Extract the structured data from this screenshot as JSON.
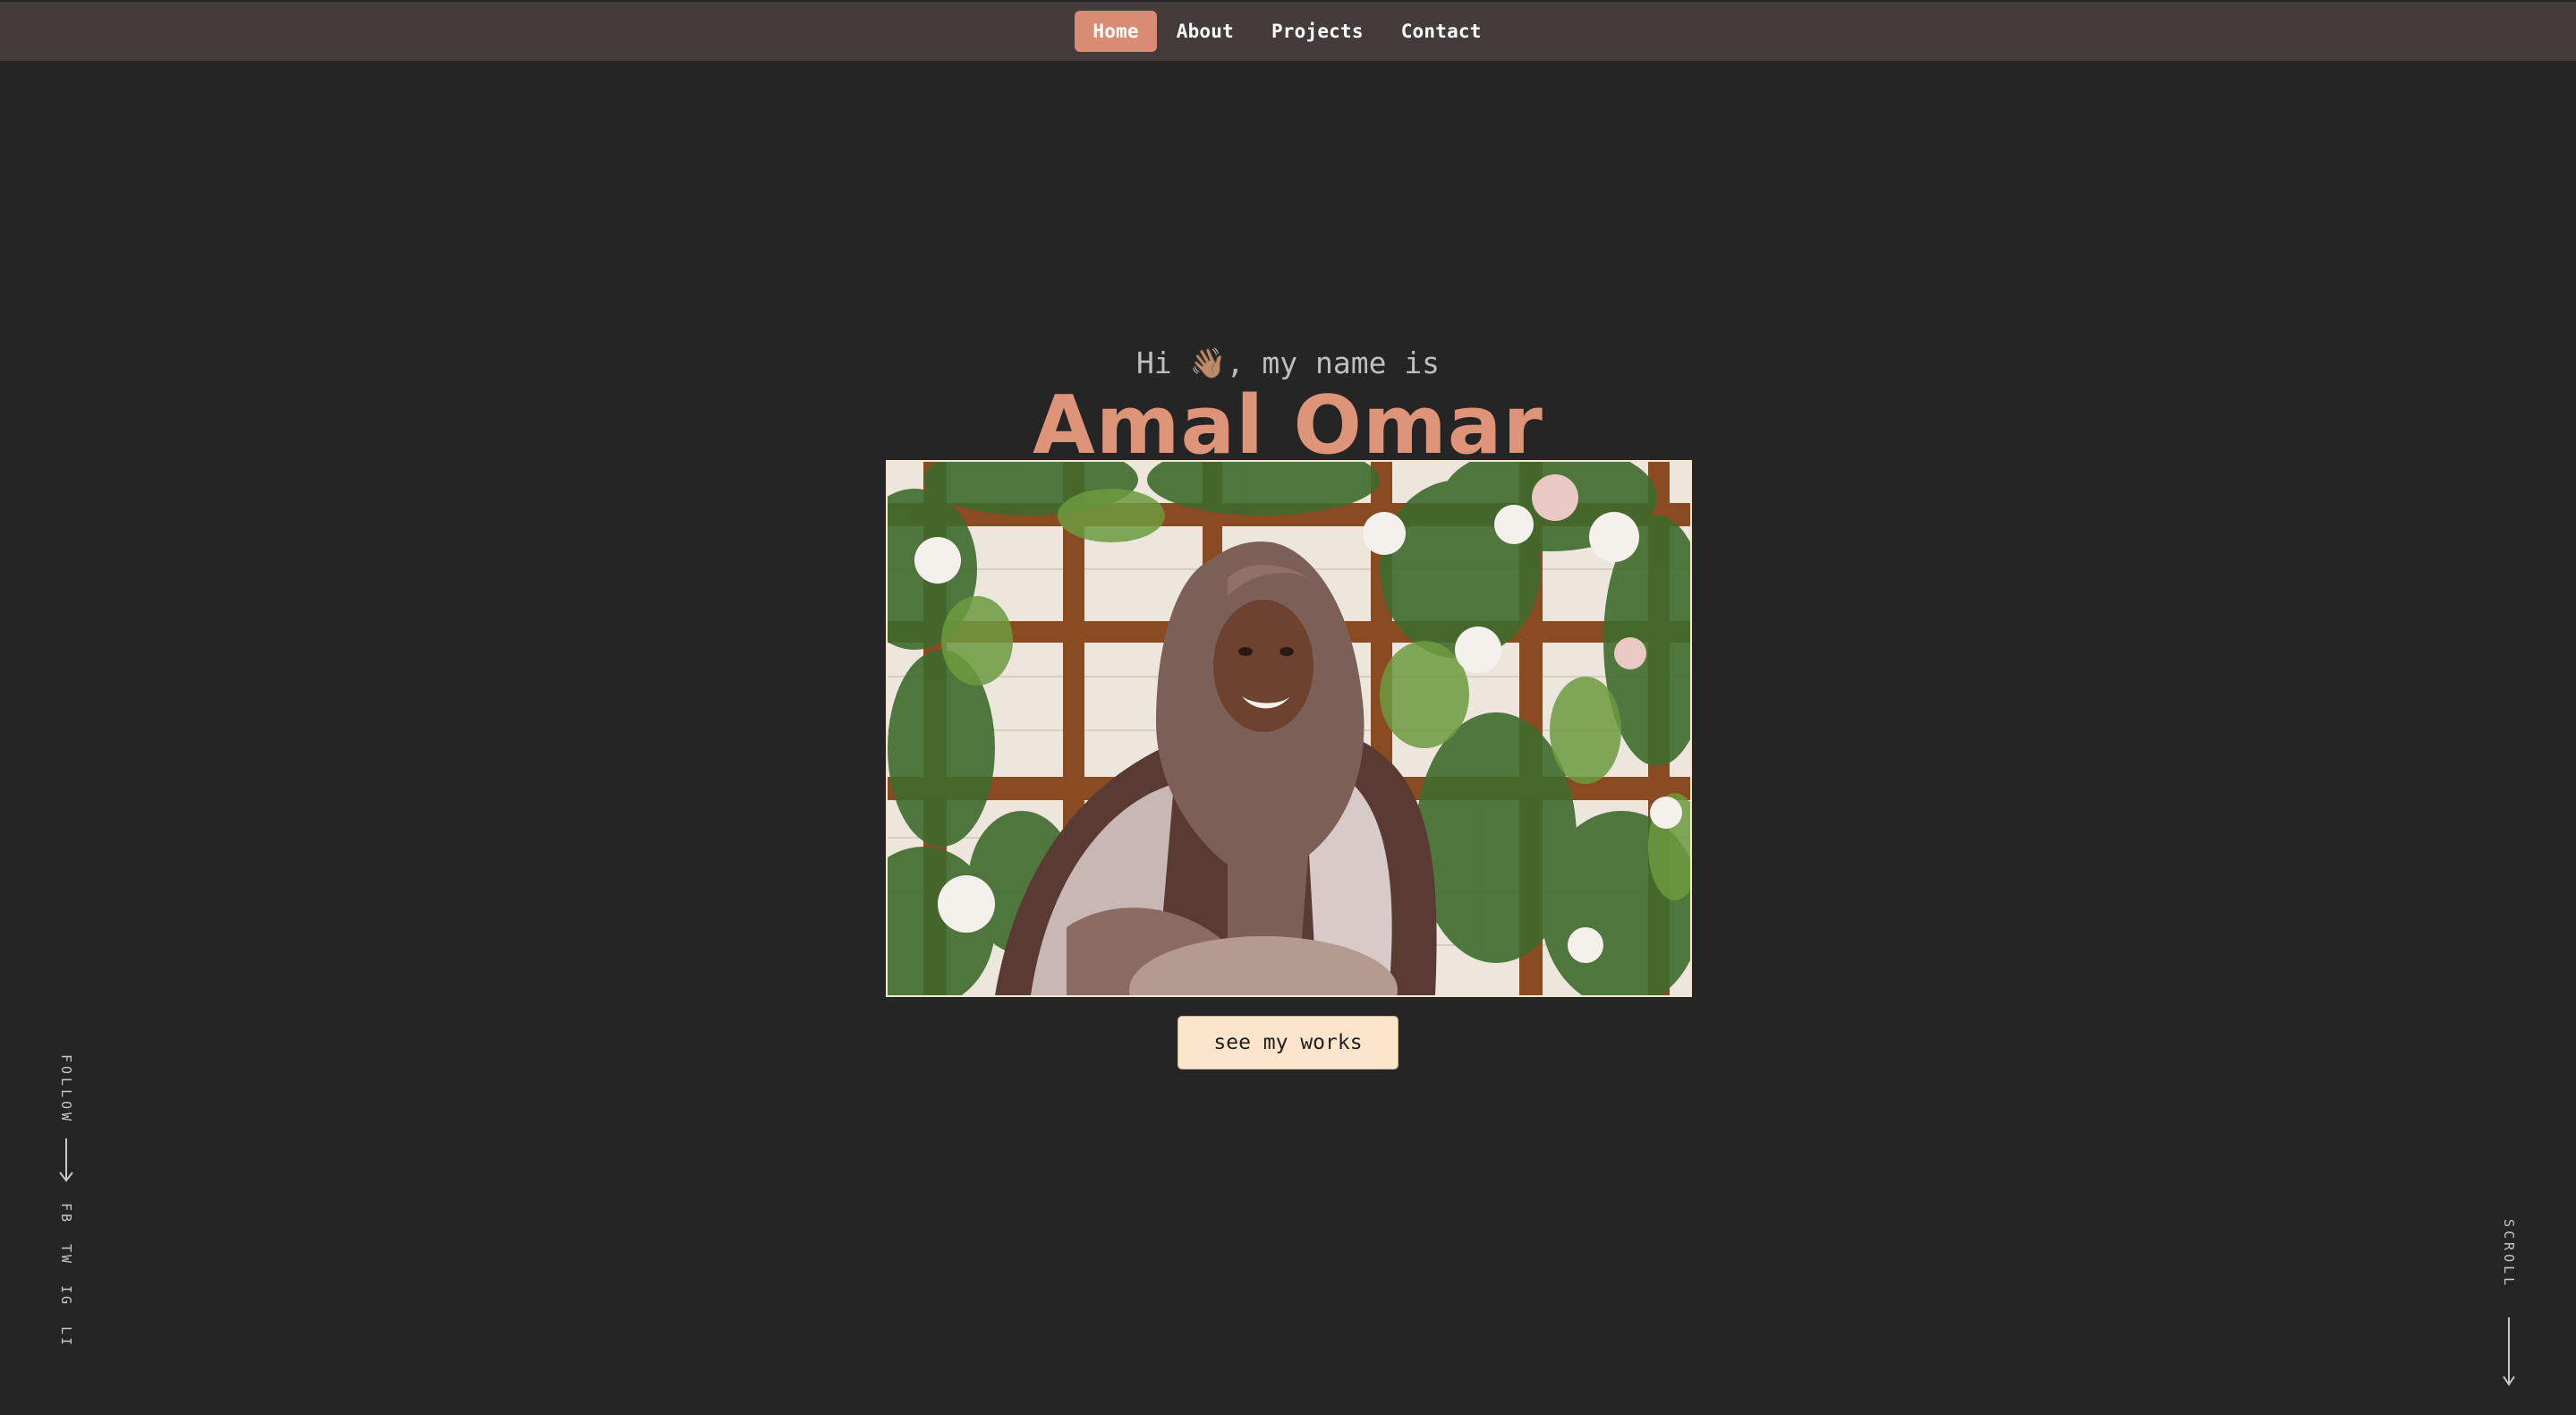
{
  "nav": {
    "items": [
      {
        "label": "Home",
        "active": true
      },
      {
        "label": "About",
        "active": false
      },
      {
        "label": "Projects",
        "active": false
      },
      {
        "label": "Contact",
        "active": false
      }
    ]
  },
  "hero": {
    "greeting_prefix": "Hi ",
    "greeting_emoji": "👋🏽",
    "greeting_suffix": ", my name is",
    "name": "Amal Omar",
    "cta_label": "see my works"
  },
  "social": {
    "follow_label": "FOLLOW",
    "links": [
      "FB",
      "TW",
      "IG",
      "LI"
    ]
  },
  "scroll": {
    "label": "SCROLL"
  },
  "colors": {
    "background": "#252525",
    "navbar": "#453b3b",
    "accent": "#de9478",
    "active_nav": "#d98c73",
    "button_bg": "#fde5cc",
    "photo_border": "#f5e6cc"
  }
}
